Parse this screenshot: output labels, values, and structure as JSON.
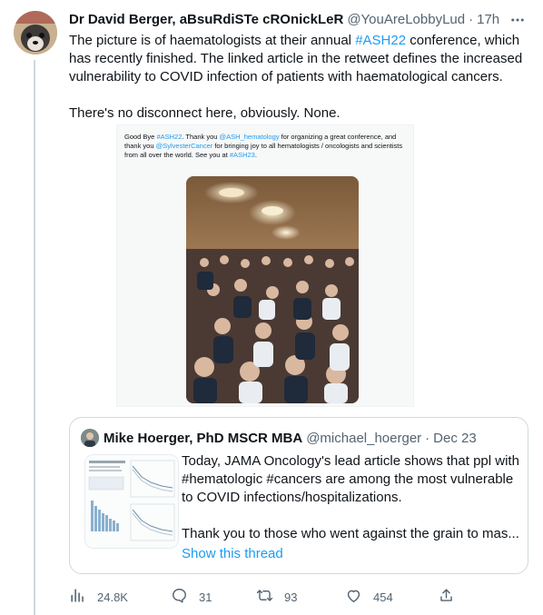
{
  "tweet": {
    "author_name": "Dr David Berger, aBsuRdiSTe cROnickLeR",
    "handle": "@YouAreLobbyLud",
    "separator": "·",
    "time": "17h",
    "text_part1": "The picture is of haematologists at their annual ",
    "hashtag": "#ASH22",
    "text_part2": " conference, which has recently finished. The linked article in the retweet defines the increased vulnerability to COVID infection of patients with haematological cancers.",
    "text_para2": "There's no disconnect here, obviously. None."
  },
  "media": {
    "caption": {
      "t1": "Good Bye ",
      "h1": "#ASH22",
      "t2": ". Thank you ",
      "h2": "@ASH_hematology",
      "t3": " for organizing a great conference, and thank you ",
      "h3": "@SylvesterCancer",
      "t4": " for bringing joy to all hematologists / oncologists and scientists from all over the world. See you at ",
      "h4": "#ASH23",
      "t5": "."
    }
  },
  "quote": {
    "author_name": "Mike Hoerger, PhD MSCR MBA",
    "handle": "@michael_hoerger",
    "separator": "·",
    "date": "Dec 23",
    "text_para1": "Today, JAMA Oncology's lead article shows that ppl with #hematologic #cancers are among the most vulnerable to COVID infections/hospitalizations.",
    "text_para2": "Thank you to those who went against the grain to mas...",
    "show_thread": "Show this thread"
  },
  "actions": {
    "views": "24.8K",
    "replies": "31",
    "retweets": "93",
    "likes": "454"
  },
  "colors": {
    "accent": "#1d9bf0",
    "muted": "#536471",
    "text": "#0f1419",
    "border": "#cfd9de"
  },
  "icons": [
    "more-icon",
    "analytics-icon",
    "reply-icon",
    "retweet-icon",
    "like-icon",
    "share-icon"
  ]
}
